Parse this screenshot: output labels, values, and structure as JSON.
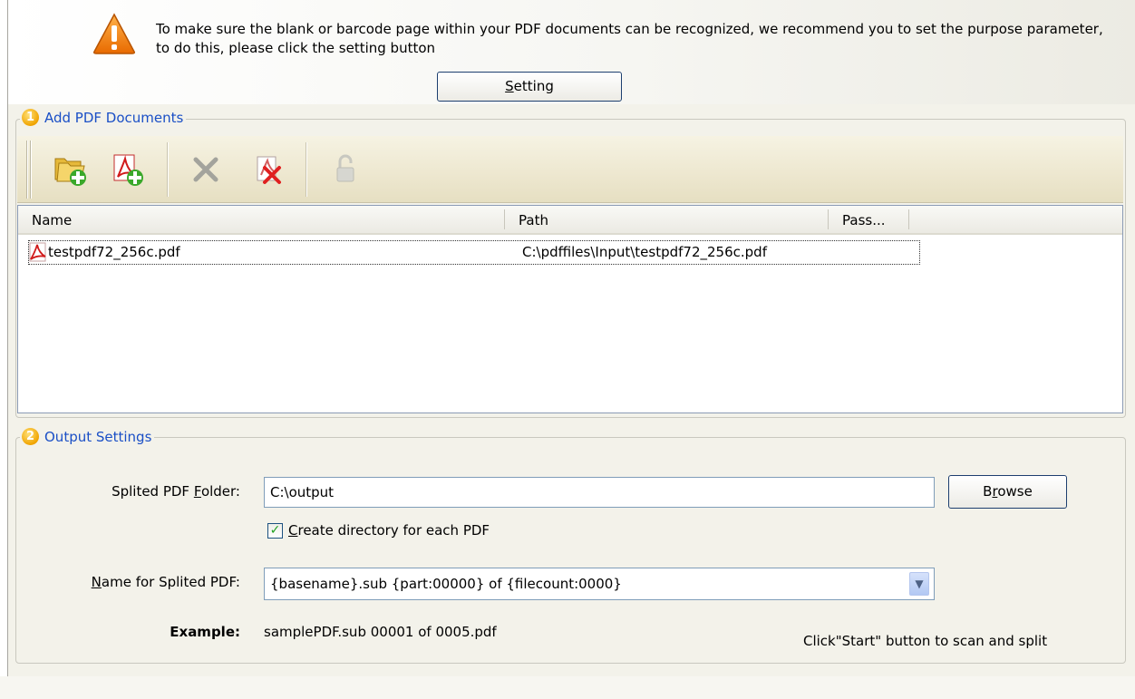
{
  "banner": {
    "message": "To make sure the blank or barcode page within your PDF documents can be recognized, we recommend you to set the purpose parameter, to do this, please click the setting button",
    "setting_button": {
      "prefix": "",
      "accel": "S",
      "rest": "etting"
    }
  },
  "add_docs": {
    "number": "1",
    "title": "Add PDF Documents",
    "toolbar": [
      {
        "name": "add-folder-icon",
        "enabled": true
      },
      {
        "name": "add-pdf-icon",
        "enabled": true
      },
      {
        "name": "remove-icon",
        "enabled": false
      },
      {
        "name": "remove-all-icon",
        "enabled": true
      },
      {
        "name": "unlock-icon",
        "enabled": false
      }
    ],
    "columns": [
      "Name",
      "Path",
      "Pass..."
    ],
    "files": [
      {
        "name": "testpdf72_256c.pdf",
        "path": "C:\\pdffiles\\Input\\testpdf72_256c.pdf",
        "password": ""
      }
    ]
  },
  "output": {
    "number": "2",
    "title": "Output Settings",
    "folder_label": {
      "prefix": "Splited PDF ",
      "accel": "F",
      "rest": "older:"
    },
    "folder_value": "C:\\output",
    "browse_button": {
      "prefix": "B",
      "accel": "r",
      "rest": "owse"
    },
    "create_dir": {
      "checked": true,
      "prefix": "",
      "accel": "C",
      "rest": "reate directory for each PDF"
    },
    "name_label": {
      "prefix": "",
      "accel": "N",
      "rest": "ame for Splited PDF:"
    },
    "name_value": "{basename}.sub {part:00000} of {filecount:0000}",
    "example_label": "Example:",
    "example_value": "samplePDF.sub 00001 of 0005.pdf",
    "hint": "Click\"Start\" button to scan and split"
  },
  "colors": {
    "accent": "#1a4fc6",
    "badge": "#f0a400",
    "check": "#21a121"
  }
}
